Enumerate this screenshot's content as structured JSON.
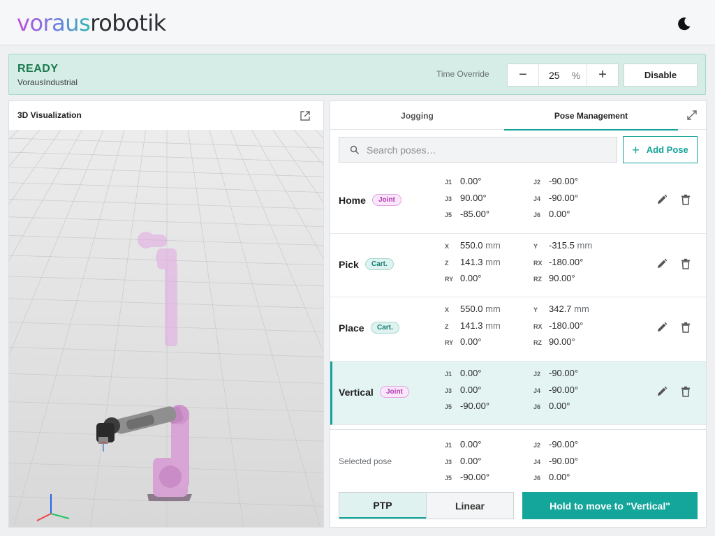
{
  "header": {
    "logo_prefix": "voraus",
    "logo_suffix": "robotik",
    "theme_icon": "moon-icon"
  },
  "status": {
    "state": "READY",
    "robot_name": "VorausIndustrial",
    "state_color": "#1a7a4e"
  },
  "override": {
    "label": "Time Override",
    "value": "25",
    "unit": "%",
    "minus_label": "−",
    "plus_label": "+"
  },
  "disable_label": "Disable",
  "visualization": {
    "title": "3D Visualization"
  },
  "tabs": [
    {
      "label": "Jogging",
      "active": false
    },
    {
      "label": "Pose Management",
      "active": true
    }
  ],
  "search": {
    "placeholder": "Search poses…",
    "value": ""
  },
  "add_pose_label": "Add Pose",
  "poses": [
    {
      "name": "Home",
      "type": "Joint",
      "values": [
        {
          "key": "J1",
          "value": "0.00°",
          "unit": ""
        },
        {
          "key": "J2",
          "value": "-90.00°",
          "unit": ""
        },
        {
          "key": "J3",
          "value": "90.00°",
          "unit": ""
        },
        {
          "key": "J4",
          "value": "-90.00°",
          "unit": ""
        },
        {
          "key": "J5",
          "value": "-85.00°",
          "unit": ""
        },
        {
          "key": "J6",
          "value": "0.00°",
          "unit": ""
        }
      ]
    },
    {
      "name": "Pick",
      "type": "Cart.",
      "values": [
        {
          "key": "X",
          "value": "550.0",
          "unit": "mm"
        },
        {
          "key": "Y",
          "value": "-315.5",
          "unit": "mm"
        },
        {
          "key": "Z",
          "value": "141.3",
          "unit": "mm"
        },
        {
          "key": "RX",
          "value": "-180.00°",
          "unit": ""
        },
        {
          "key": "RY",
          "value": "0.00°",
          "unit": ""
        },
        {
          "key": "RZ",
          "value": "90.00°",
          "unit": ""
        }
      ]
    },
    {
      "name": "Place",
      "type": "Cart.",
      "values": [
        {
          "key": "X",
          "value": "550.0",
          "unit": "mm"
        },
        {
          "key": "Y",
          "value": "342.7",
          "unit": "mm"
        },
        {
          "key": "Z",
          "value": "141.3",
          "unit": "mm"
        },
        {
          "key": "RX",
          "value": "-180.00°",
          "unit": ""
        },
        {
          "key": "RY",
          "value": "0.00°",
          "unit": ""
        },
        {
          "key": "RZ",
          "value": "90.00°",
          "unit": ""
        }
      ]
    },
    {
      "name": "Vertical",
      "type": "Joint",
      "selected": true,
      "values": [
        {
          "key": "J1",
          "value": "0.00°",
          "unit": ""
        },
        {
          "key": "J2",
          "value": "-90.00°",
          "unit": ""
        },
        {
          "key": "J3",
          "value": "0.00°",
          "unit": ""
        },
        {
          "key": "J4",
          "value": "-90.00°",
          "unit": ""
        },
        {
          "key": "J5",
          "value": "-90.00°",
          "unit": ""
        },
        {
          "key": "J6",
          "value": "0.00°",
          "unit": ""
        }
      ]
    }
  ],
  "selected_pose": {
    "label": "Selected pose",
    "values": [
      {
        "key": "J1",
        "value": "0.00°",
        "unit": ""
      },
      {
        "key": "J2",
        "value": "-90.00°",
        "unit": ""
      },
      {
        "key": "J3",
        "value": "0.00°",
        "unit": ""
      },
      {
        "key": "J4",
        "value": "-90.00°",
        "unit": ""
      },
      {
        "key": "J5",
        "value": "-90.00°",
        "unit": ""
      },
      {
        "key": "J6",
        "value": "0.00°",
        "unit": ""
      }
    ]
  },
  "motion": {
    "options": [
      "PTP",
      "Linear"
    ],
    "active": "PTP",
    "move_label": "Hold to move to \"Vertical\""
  },
  "colors": {
    "accent": "#13a39a",
    "joint_badge": "#b23cb2",
    "cart_badge": "#157f75",
    "status_bg": "#d5ede6"
  }
}
